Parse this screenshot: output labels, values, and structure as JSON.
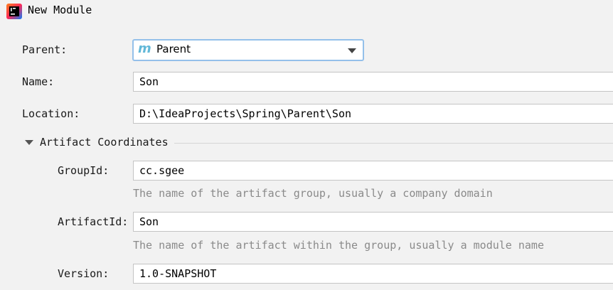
{
  "window": {
    "title": "New Module",
    "icon": "intellij-idea-icon"
  },
  "form": {
    "parent": {
      "label": "Parent:",
      "value": "Parent",
      "icon": "maven-module-icon"
    },
    "name": {
      "label": "Name:",
      "value": "Son"
    },
    "location": {
      "label": "Location:",
      "value": "D:\\IdeaProjects\\Spring\\Parent\\Son"
    }
  },
  "artifact": {
    "section_title": "Artifact Coordinates",
    "group_id": {
      "label": "GroupId:",
      "value": "cc.sgee",
      "hint": "The name of the artifact group, usually a company domain"
    },
    "artifact_id": {
      "label": "ArtifactId:",
      "value": "Son",
      "hint": "The name of the artifact within the group, usually a module name"
    },
    "version": {
      "label": "Version:",
      "value": "1.0-SNAPSHOT"
    }
  },
  "colors": {
    "background": "#f2f2f2",
    "focus_border": "#94c0ea",
    "hint_text": "#8a8a8a",
    "maven_icon": "#62b8d8"
  }
}
